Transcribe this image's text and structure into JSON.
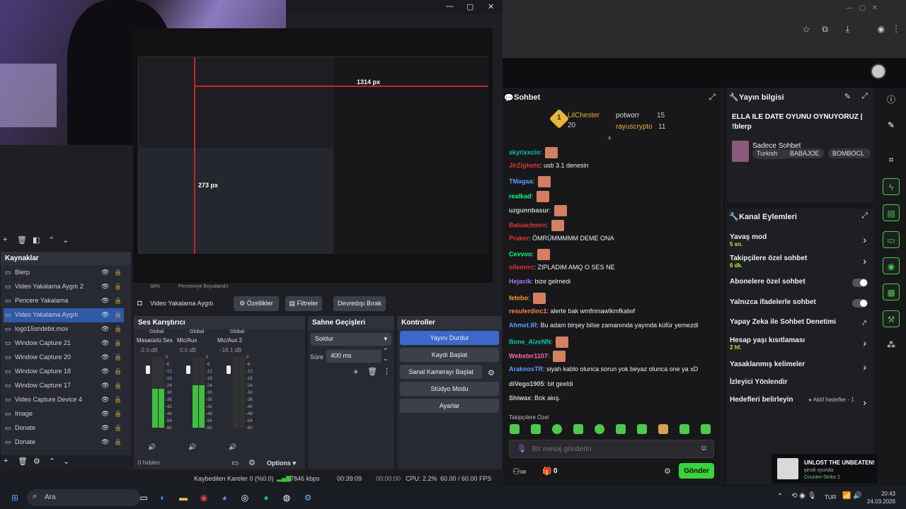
{
  "obs": {
    "preview_px_top": "1314 px",
    "preview_px_inner": "273 px",
    "sources_title": "Kaynaklar",
    "sources": [
      {
        "label": "Blerp",
        "selected": false
      },
      {
        "label": "Video Yakalama Aygıtı 2",
        "selected": false
      },
      {
        "label": "Pencere Yakalama",
        "selected": false
      },
      {
        "label": "Video Yakalama Aygıtı",
        "selected": true
      },
      {
        "label": "logo15sndebir.mov",
        "selected": false
      },
      {
        "label": "Window Capture 21",
        "selected": false
      },
      {
        "label": "Window Capture 20",
        "selected": false
      },
      {
        "label": "Window Capture 18",
        "selected": false
      },
      {
        "label": "Window Capture 17",
        "selected": false
      },
      {
        "label": "Video Capture Device 4",
        "selected": false
      },
      {
        "label": "Image",
        "selected": false
      },
      {
        "label": "Donate",
        "selected": false
      },
      {
        "label": "Donate",
        "selected": false
      }
    ],
    "zoom": "38%",
    "fit_label": "Pencereye Boyutlandır",
    "selected_source": "Video Yakalama Aygıtı",
    "props_label": "Özellikler",
    "filters_label": "Filtreler",
    "deactivate_label": "Devredışı Bırak",
    "mixer_title": "Ses Karıştırıcı",
    "mixer": [
      {
        "scope": "Global",
        "name": "Masaüstü Ses",
        "db": "-2.0 dB",
        "level": 0.55
      },
      {
        "scope": "Global",
        "name": "Mic/Aux",
        "db": "0.0 dB",
        "level": 0.6
      },
      {
        "scope": "Global",
        "name": "Mic/Aux 2",
        "db": "-18.1 dB",
        "level": 0.0
      }
    ],
    "meter_ticks": [
      "0",
      "-6",
      "-12",
      "-18",
      "-24",
      "-30",
      "-36",
      "-42",
      "-48",
      "-54",
      "-60"
    ],
    "hidden_label": "0 hidden",
    "options_label": "Options",
    "transitions_title": "Sahne Geçişleri",
    "transition_value": "Soldur",
    "duration_label": "Süre",
    "duration_value": "400 ms",
    "controls_title": "Kontroller",
    "controls": [
      "Yayını Durdur",
      "Kaydı Başlat",
      "Sanal Kamerayı Başlat",
      "Stüdyo Modu",
      "Ayarlar"
    ],
    "status": {
      "dropped": "Kaybedilen Kareler 0 (%0.0)",
      "bitrate": "7846 kbps",
      "live_time": "00:39:09",
      "rec_time": "00:00:00",
      "cpu": "CPU: 2.2%",
      "fps": "60.00 / 60.00 FPS"
    }
  },
  "chat": {
    "title": "Sohbet",
    "top_gifters": [
      {
        "rank": "1",
        "name": "LilChester",
        "count": "20"
      },
      {
        "rank": "",
        "name": "potworr",
        "count": "15"
      },
      {
        "rank": "",
        "name": "rayuscrypto",
        "count": "11"
      }
    ],
    "messages": [
      {
        "user": "skyrixxcio",
        "color": "#00c8af",
        "text": "",
        "emote": true
      },
      {
        "user": "JirZighoto",
        "color": "#e63232",
        "text": "usb 3.1 denesin",
        "emote": false
      },
      {
        "user": "TMagaa",
        "color": "#5b9bff",
        "text": "",
        "emote": true
      },
      {
        "user": "realkad",
        "color": "#00ff7f",
        "text": "",
        "emote": true
      },
      {
        "user": "uzgunnbasur",
        "color": "#cccccc",
        "text": "",
        "emote": true
      },
      {
        "user": "Batuachmrn",
        "color": "#e63232",
        "text": "",
        "emote": true
      },
      {
        "user": "Praker",
        "color": "#e63232",
        "text": "ÖMRÜMMMMM DEME ONA",
        "emote": false
      },
      {
        "user": "Cevvoo",
        "color": "#00ff7f",
        "text": "",
        "emote": true
      },
      {
        "user": "ollemrrc",
        "color": "#e63232",
        "text": "ZIPLADIM AMQ O SES NE",
        "emote": false
      },
      {
        "user": "Hejacik",
        "color": "#a970ff",
        "text": "bize gelmedi",
        "emote": false
      },
      {
        "user": "fetebo",
        "color": "#ff9f1a",
        "text": "",
        "emote": true
      },
      {
        "user": "resulerdinc1",
        "color": "#ff7f50",
        "text": "alerte bak wmfnmawlkmfkalwf",
        "emote": false
      },
      {
        "user": "Ahmet.IR",
        "color": "#5b9bff",
        "text": "Bu adam birşey bilse zamanında yayında küfür yemezdi",
        "emote": false
      },
      {
        "user": "Bone_AizeNN",
        "color": "#00c8af",
        "text": "",
        "emote": true
      },
      {
        "user": "Webster1107",
        "color": "#ff69b4",
        "text": "",
        "emote": true
      },
      {
        "user": "AraknosTR",
        "color": "#5b9bff",
        "text": "siyah kablo olunca sorun yok beyaz olunca one ya xD",
        "emote": false
      },
      {
        "user": "diVego1905",
        "color": "#cccccc",
        "text": "bit geeldi",
        "emote": false
      },
      {
        "user": "Shiwax",
        "color": "#cccccc",
        "text": "Bok akış.",
        "emote": false
      }
    ],
    "followers_label": "Takipçilere Özel",
    "input_placeholder": "Bir mesaj gönderin",
    "points": "0",
    "send_label": "Gönder"
  },
  "stream_info": {
    "title": "Yayın bilgisi",
    "stream_title": "ELLA ILE DATE OYUNU OYNUYORUZ | !blerp",
    "category": "Sadece Sohbet",
    "tags": [
      "Turkish",
      "BABAJOE",
      "BOMBOCL"
    ]
  },
  "channel_actions": {
    "title": "Kanal Eylemleri",
    "items": [
      {
        "label": "Yavaş mod",
        "sub": "5 sn.",
        "control": "chevron"
      },
      {
        "label": "Takipçilere özel sohbet",
        "sub": "6 dk.",
        "control": "chevron"
      },
      {
        "label": "Abonelere özel sohbet",
        "sub": "",
        "control": "toggle"
      },
      {
        "label": "Yalnızca ifadelerle sohbet",
        "sub": "",
        "control": "toggle"
      },
      {
        "label": "Yapay Zeka ile Sohbet Denetimi",
        "sub": "",
        "control": "external"
      },
      {
        "label": "Hesap yaşı kısıtlaması",
        "sub": "2 hf.",
        "control": "chevron"
      },
      {
        "label": "Yasaklanmış kelimeler",
        "sub": "",
        "control": "chevron"
      },
      {
        "label": "İzleyici Yönlendir",
        "sub": "",
        "control": "none"
      },
      {
        "label": "Hedefleri belirleyin",
        "sub": "",
        "control": "chevron"
      }
    ],
    "goals_status": "Aktif hedefler - 1"
  },
  "notification": {
    "title": "UNLOST THE UNBEATEN!",
    "sub1": "şimdi oyunda",
    "sub2": "Counter-Strike 2"
  },
  "taskbar": {
    "search": "Ara",
    "lang": "TUR",
    "time": "20:43",
    "date": "24.03.2026"
  }
}
